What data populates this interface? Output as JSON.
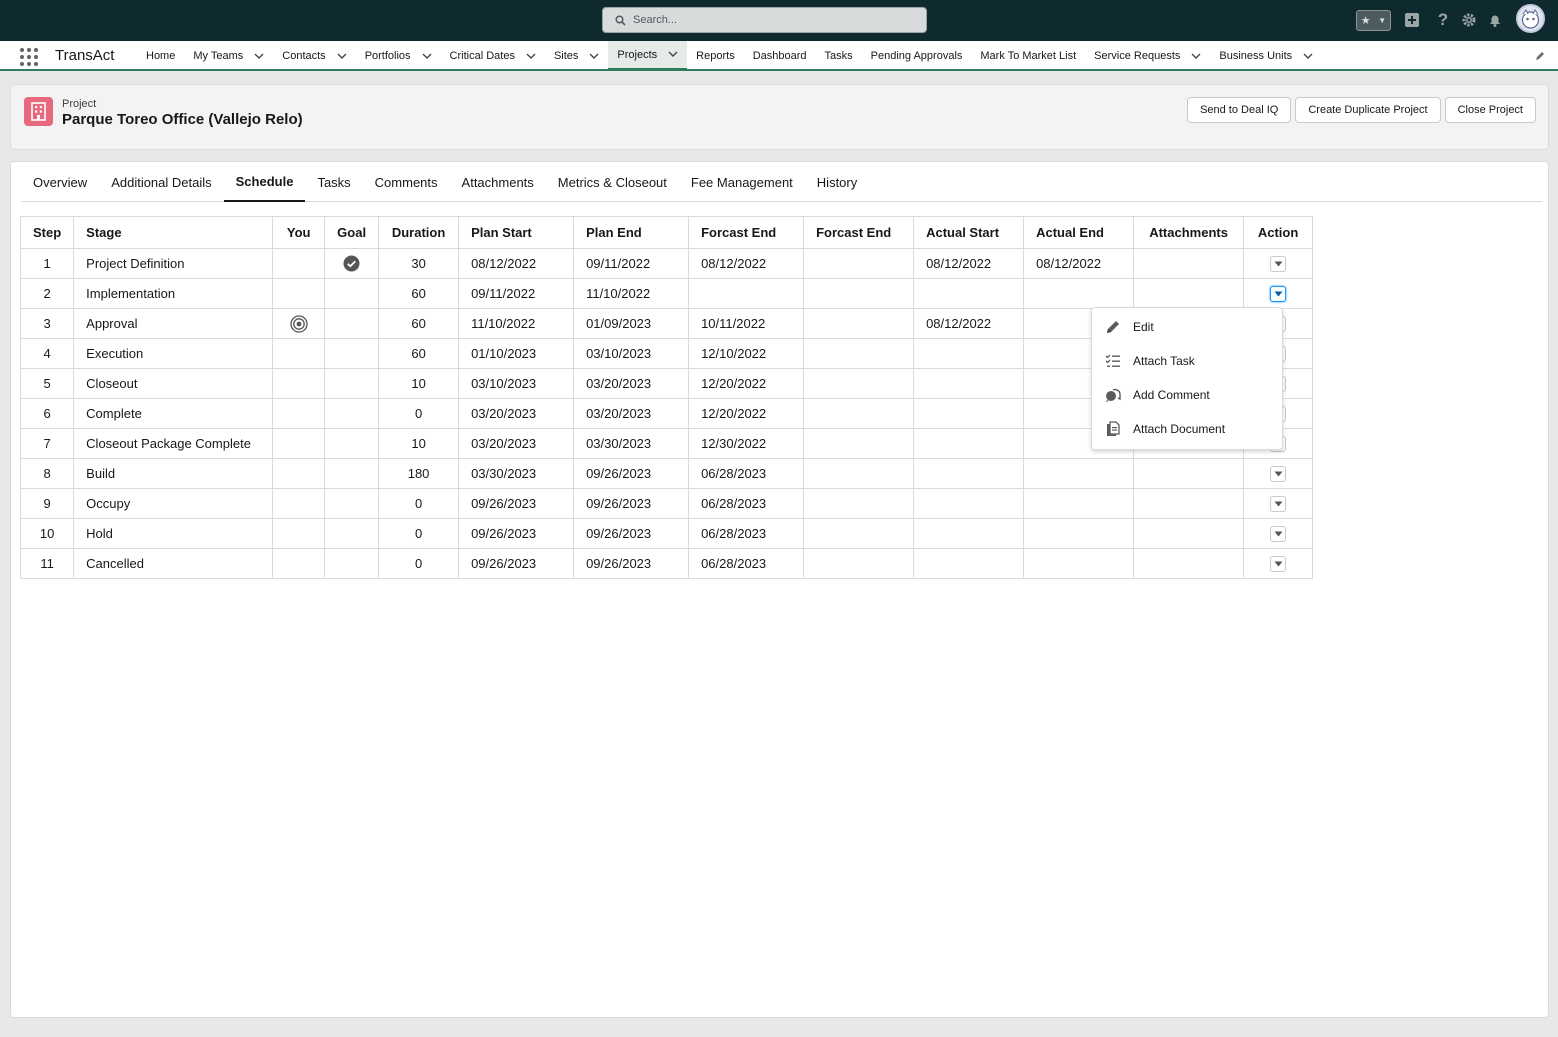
{
  "header": {
    "search_placeholder": "Search...",
    "icons": [
      "star-icon",
      "add-icon",
      "help-icon",
      "setup-gear-icon",
      "notification-bell-icon",
      "user-avatar"
    ]
  },
  "nav": {
    "app_name": "TransAct",
    "items": [
      {
        "label": "Home",
        "has_menu": false
      },
      {
        "label": "My Teams",
        "has_menu": true
      },
      {
        "label": "Contacts",
        "has_menu": true
      },
      {
        "label": "Portfolios",
        "has_menu": true
      },
      {
        "label": "Critical Dates",
        "has_menu": true
      },
      {
        "label": "Sites",
        "has_menu": true
      },
      {
        "label": "Projects",
        "has_menu": true,
        "active": true
      },
      {
        "label": "Reports",
        "has_menu": false
      },
      {
        "label": "Dashboard",
        "has_menu": false
      },
      {
        "label": "Tasks",
        "has_menu": false
      },
      {
        "label": "Pending Approvals",
        "has_menu": false
      },
      {
        "label": "Mark To Market List",
        "has_menu": false
      },
      {
        "label": "Service Requests",
        "has_menu": true
      },
      {
        "label": "Business Units",
        "has_menu": true
      }
    ]
  },
  "record": {
    "type": "Project",
    "title": "Parque Toreo Office (Vallejo Relo)",
    "actions": [
      "Send to Deal IQ",
      "Create Duplicate Project",
      "Close Project"
    ]
  },
  "tabs": [
    "Overview",
    "Additional Details",
    "Schedule",
    "Tasks",
    "Comments",
    "Attachments",
    "Metrics & Closeout",
    "Fee Management",
    "History"
  ],
  "active_tab": "Schedule",
  "schedule": {
    "columns": [
      "Step",
      "Stage",
      "You",
      "Goal",
      "Duration",
      "Plan Start",
      "Plan End",
      "Forcast End",
      "Forcast End",
      "Actual Start",
      "Actual End",
      "Attachments",
      "Action"
    ],
    "rows": [
      {
        "step": "1",
        "stage": "Project Definition",
        "you": "",
        "goal": "check",
        "duration": "30",
        "plan_start": "08/12/2022",
        "plan_end": "09/11/2022",
        "forecast_end": "08/12/2022",
        "forecast_end_2": "",
        "actual_start": "08/12/2022",
        "actual_end": "08/12/2022",
        "attachments": ""
      },
      {
        "step": "2",
        "stage": "Implementation",
        "you": "",
        "goal": "",
        "duration": "60",
        "plan_start": "09/11/2022",
        "plan_end": "11/10/2022",
        "forecast_end": "",
        "forecast_end_2": "",
        "actual_start": "",
        "actual_end": "",
        "attachments": "",
        "menu_open": true
      },
      {
        "step": "3",
        "stage": "Approval",
        "you": "target",
        "goal": "",
        "duration": "60",
        "plan_start": "11/10/2022",
        "plan_end": "01/09/2023",
        "forecast_end": "10/11/2022",
        "forecast_end_2": "",
        "actual_start": "08/12/2022",
        "actual_end": "",
        "attachments": ""
      },
      {
        "step": "4",
        "stage": "Execution",
        "you": "",
        "goal": "",
        "duration": "60",
        "plan_start": "01/10/2023",
        "plan_end": "03/10/2023",
        "forecast_end": "12/10/2022",
        "forecast_end_2": "",
        "actual_start": "",
        "actual_end": "",
        "attachments": ""
      },
      {
        "step": "5",
        "stage": "Closeout",
        "you": "",
        "goal": "",
        "duration": "10",
        "plan_start": "03/10/2023",
        "plan_end": "03/20/2023",
        "forecast_end": "12/20/2022",
        "forecast_end_2": "",
        "actual_start": "",
        "actual_end": "",
        "attachments": ""
      },
      {
        "step": "6",
        "stage": "Complete",
        "you": "",
        "goal": "",
        "duration": "0",
        "plan_start": "03/20/2023",
        "plan_end": "03/20/2023",
        "forecast_end": "12/20/2022",
        "forecast_end_2": "",
        "actual_start": "",
        "actual_end": "",
        "attachments": ""
      },
      {
        "step": "7",
        "stage": "Closeout Package Complete",
        "you": "",
        "goal": "",
        "duration": "10",
        "plan_start": "03/20/2023",
        "plan_end": "03/30/2023",
        "forecast_end": "12/30/2022",
        "forecast_end_2": "",
        "actual_start": "",
        "actual_end": "",
        "attachments": ""
      },
      {
        "step": "8",
        "stage": "Build",
        "you": "",
        "goal": "",
        "duration": "180",
        "plan_start": "03/30/2023",
        "plan_end": "09/26/2023",
        "forecast_end": "06/28/2023",
        "forecast_end_2": "",
        "actual_start": "",
        "actual_end": "",
        "attachments": ""
      },
      {
        "step": "9",
        "stage": "Occupy",
        "you": "",
        "goal": "",
        "duration": "0",
        "plan_start": "09/26/2023",
        "plan_end": "09/26/2023",
        "forecast_end": "06/28/2023",
        "forecast_end_2": "",
        "actual_start": "",
        "actual_end": "",
        "attachments": ""
      },
      {
        "step": "10",
        "stage": "Hold",
        "you": "",
        "goal": "",
        "duration": "0",
        "plan_start": "09/26/2023",
        "plan_end": "09/26/2023",
        "forecast_end": "06/28/2023",
        "forecast_end_2": "",
        "actual_start": "",
        "actual_end": "",
        "attachments": ""
      },
      {
        "step": "11",
        "stage": "Cancelled",
        "you": "",
        "goal": "",
        "duration": "0",
        "plan_start": "09/26/2023",
        "plan_end": "09/26/2023",
        "forecast_end": "06/28/2023",
        "forecast_end_2": "",
        "actual_start": "",
        "actual_end": "",
        "attachments": ""
      }
    ]
  },
  "row_menu": {
    "items": [
      {
        "label": "Edit",
        "icon": "edit-pencil-icon"
      },
      {
        "label": "Attach Task",
        "icon": "task-list-icon"
      },
      {
        "label": "Add Comment",
        "icon": "comment-icon"
      },
      {
        "label": "Attach Document",
        "icon": "document-icon"
      }
    ]
  },
  "colors": {
    "header_bg": "#0f2a2e",
    "nav_accent": "#2e7d5c",
    "record_icon": "#e8697d",
    "focus_blue": "#1b96ff"
  }
}
